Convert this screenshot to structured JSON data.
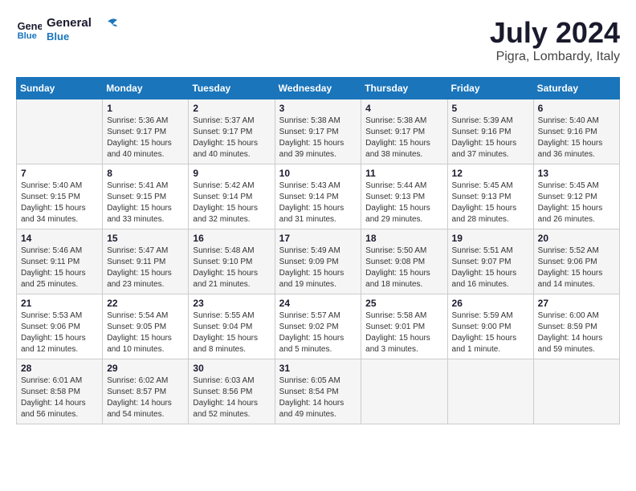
{
  "header": {
    "logo_line1": "General",
    "logo_line2": "Blue",
    "month_year": "July 2024",
    "location": "Pigra, Lombardy, Italy"
  },
  "columns": [
    "Sunday",
    "Monday",
    "Tuesday",
    "Wednesday",
    "Thursday",
    "Friday",
    "Saturday"
  ],
  "weeks": [
    [
      {
        "day": "",
        "sunrise": "",
        "sunset": "",
        "daylight": ""
      },
      {
        "day": "1",
        "sunrise": "Sunrise: 5:36 AM",
        "sunset": "Sunset: 9:17 PM",
        "daylight": "Daylight: 15 hours and 40 minutes."
      },
      {
        "day": "2",
        "sunrise": "Sunrise: 5:37 AM",
        "sunset": "Sunset: 9:17 PM",
        "daylight": "Daylight: 15 hours and 40 minutes."
      },
      {
        "day": "3",
        "sunrise": "Sunrise: 5:38 AM",
        "sunset": "Sunset: 9:17 PM",
        "daylight": "Daylight: 15 hours and 39 minutes."
      },
      {
        "day": "4",
        "sunrise": "Sunrise: 5:38 AM",
        "sunset": "Sunset: 9:17 PM",
        "daylight": "Daylight: 15 hours and 38 minutes."
      },
      {
        "day": "5",
        "sunrise": "Sunrise: 5:39 AM",
        "sunset": "Sunset: 9:16 PM",
        "daylight": "Daylight: 15 hours and 37 minutes."
      },
      {
        "day": "6",
        "sunrise": "Sunrise: 5:40 AM",
        "sunset": "Sunset: 9:16 PM",
        "daylight": "Daylight: 15 hours and 36 minutes."
      }
    ],
    [
      {
        "day": "7",
        "sunrise": "Sunrise: 5:40 AM",
        "sunset": "Sunset: 9:15 PM",
        "daylight": "Daylight: 15 hours and 34 minutes."
      },
      {
        "day": "8",
        "sunrise": "Sunrise: 5:41 AM",
        "sunset": "Sunset: 9:15 PM",
        "daylight": "Daylight: 15 hours and 33 minutes."
      },
      {
        "day": "9",
        "sunrise": "Sunrise: 5:42 AM",
        "sunset": "Sunset: 9:14 PM",
        "daylight": "Daylight: 15 hours and 32 minutes."
      },
      {
        "day": "10",
        "sunrise": "Sunrise: 5:43 AM",
        "sunset": "Sunset: 9:14 PM",
        "daylight": "Daylight: 15 hours and 31 minutes."
      },
      {
        "day": "11",
        "sunrise": "Sunrise: 5:44 AM",
        "sunset": "Sunset: 9:13 PM",
        "daylight": "Daylight: 15 hours and 29 minutes."
      },
      {
        "day": "12",
        "sunrise": "Sunrise: 5:45 AM",
        "sunset": "Sunset: 9:13 PM",
        "daylight": "Daylight: 15 hours and 28 minutes."
      },
      {
        "day": "13",
        "sunrise": "Sunrise: 5:45 AM",
        "sunset": "Sunset: 9:12 PM",
        "daylight": "Daylight: 15 hours and 26 minutes."
      }
    ],
    [
      {
        "day": "14",
        "sunrise": "Sunrise: 5:46 AM",
        "sunset": "Sunset: 9:11 PM",
        "daylight": "Daylight: 15 hours and 25 minutes."
      },
      {
        "day": "15",
        "sunrise": "Sunrise: 5:47 AM",
        "sunset": "Sunset: 9:11 PM",
        "daylight": "Daylight: 15 hours and 23 minutes."
      },
      {
        "day": "16",
        "sunrise": "Sunrise: 5:48 AM",
        "sunset": "Sunset: 9:10 PM",
        "daylight": "Daylight: 15 hours and 21 minutes."
      },
      {
        "day": "17",
        "sunrise": "Sunrise: 5:49 AM",
        "sunset": "Sunset: 9:09 PM",
        "daylight": "Daylight: 15 hours and 19 minutes."
      },
      {
        "day": "18",
        "sunrise": "Sunrise: 5:50 AM",
        "sunset": "Sunset: 9:08 PM",
        "daylight": "Daylight: 15 hours and 18 minutes."
      },
      {
        "day": "19",
        "sunrise": "Sunrise: 5:51 AM",
        "sunset": "Sunset: 9:07 PM",
        "daylight": "Daylight: 15 hours and 16 minutes."
      },
      {
        "day": "20",
        "sunrise": "Sunrise: 5:52 AM",
        "sunset": "Sunset: 9:06 PM",
        "daylight": "Daylight: 15 hours and 14 minutes."
      }
    ],
    [
      {
        "day": "21",
        "sunrise": "Sunrise: 5:53 AM",
        "sunset": "Sunset: 9:06 PM",
        "daylight": "Daylight: 15 hours and 12 minutes."
      },
      {
        "day": "22",
        "sunrise": "Sunrise: 5:54 AM",
        "sunset": "Sunset: 9:05 PM",
        "daylight": "Daylight: 15 hours and 10 minutes."
      },
      {
        "day": "23",
        "sunrise": "Sunrise: 5:55 AM",
        "sunset": "Sunset: 9:04 PM",
        "daylight": "Daylight: 15 hours and 8 minutes."
      },
      {
        "day": "24",
        "sunrise": "Sunrise: 5:57 AM",
        "sunset": "Sunset: 9:02 PM",
        "daylight": "Daylight: 15 hours and 5 minutes."
      },
      {
        "day": "25",
        "sunrise": "Sunrise: 5:58 AM",
        "sunset": "Sunset: 9:01 PM",
        "daylight": "Daylight: 15 hours and 3 minutes."
      },
      {
        "day": "26",
        "sunrise": "Sunrise: 5:59 AM",
        "sunset": "Sunset: 9:00 PM",
        "daylight": "Daylight: 15 hours and 1 minute."
      },
      {
        "day": "27",
        "sunrise": "Sunrise: 6:00 AM",
        "sunset": "Sunset: 8:59 PM",
        "daylight": "Daylight: 14 hours and 59 minutes."
      }
    ],
    [
      {
        "day": "28",
        "sunrise": "Sunrise: 6:01 AM",
        "sunset": "Sunset: 8:58 PM",
        "daylight": "Daylight: 14 hours and 56 minutes."
      },
      {
        "day": "29",
        "sunrise": "Sunrise: 6:02 AM",
        "sunset": "Sunset: 8:57 PM",
        "daylight": "Daylight: 14 hours and 54 minutes."
      },
      {
        "day": "30",
        "sunrise": "Sunrise: 6:03 AM",
        "sunset": "Sunset: 8:56 PM",
        "daylight": "Daylight: 14 hours and 52 minutes."
      },
      {
        "day": "31",
        "sunrise": "Sunrise: 6:05 AM",
        "sunset": "Sunset: 8:54 PM",
        "daylight": "Daylight: 14 hours and 49 minutes."
      },
      {
        "day": "",
        "sunrise": "",
        "sunset": "",
        "daylight": ""
      },
      {
        "day": "",
        "sunrise": "",
        "sunset": "",
        "daylight": ""
      },
      {
        "day": "",
        "sunrise": "",
        "sunset": "",
        "daylight": ""
      }
    ]
  ]
}
